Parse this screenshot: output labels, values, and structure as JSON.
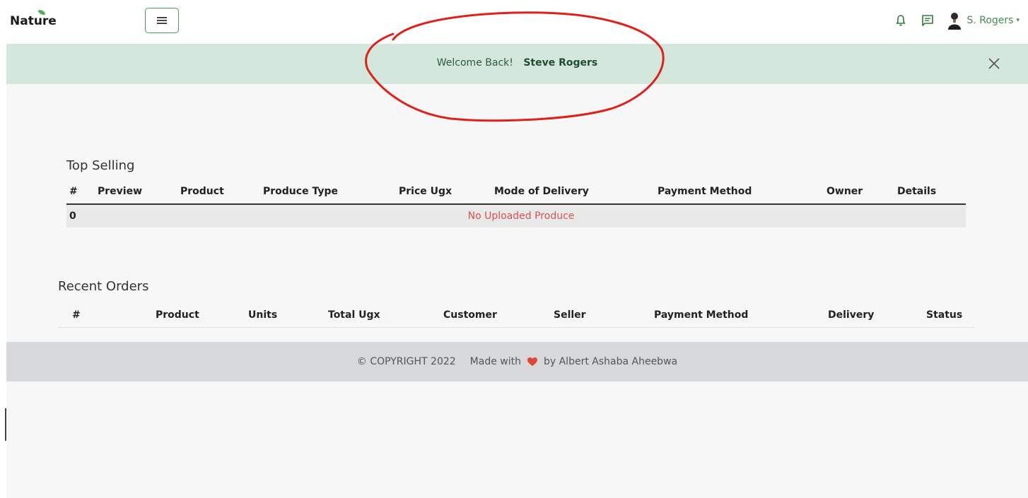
{
  "brand": {
    "name": "Nature",
    "leaf_color": "#4caf50"
  },
  "navbar": {
    "menu_icon": "hamburger-icon",
    "bell_icon": "bell-icon",
    "messages_icon": "message-icon",
    "user_name": "S. Rogers",
    "caret": "▾",
    "accent_color": "#3f8f4f"
  },
  "alert": {
    "greeting": "Welcome Back!",
    "user_full_name": "Steve Rogers",
    "close_icon": "close-icon",
    "background": "#d3e7dd"
  },
  "annotation": {
    "shape": "hand-drawn-ellipse",
    "color": "#e0201b"
  },
  "top_selling": {
    "title": "Top Selling",
    "columns": [
      "#",
      "Preview",
      "Product",
      "Produce Type",
      "Price Ugx",
      "Mode of Delivery",
      "Payment Method",
      "Owner",
      "Details"
    ],
    "rows": [
      {
        "index": "0",
        "message": "No Uploaded Produce"
      }
    ]
  },
  "recent_orders": {
    "title": "Recent Orders",
    "columns": [
      "#",
      "Product",
      "Units",
      "Total Ugx",
      "Customer",
      "Seller",
      "Payment Method",
      "Delivery",
      "Status"
    ]
  },
  "footer": {
    "copyright": "© COPYRIGHT 2022",
    "made_with": "Made with",
    "by": "by Albert Ashaba Aheebwa",
    "heart_color": "#e0453a"
  }
}
